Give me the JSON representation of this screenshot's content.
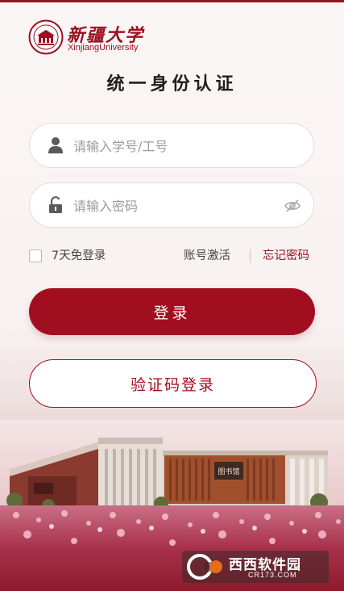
{
  "logo": {
    "name_cn": "新疆大学",
    "name_en": "XinjiangUniversity"
  },
  "title": "统一身份认证",
  "form": {
    "username_placeholder": "请输入学号/工号",
    "username_value": "",
    "password_placeholder": "请输入密码",
    "password_value": ""
  },
  "options": {
    "remember_label": "7天免登录",
    "remember_checked": false,
    "activate_label": "账号激活",
    "forgot_label": "忘记密码"
  },
  "buttons": {
    "login_label": "登录",
    "code_login_label": "验证码登录"
  },
  "building_sign": "图书馆",
  "watermark": {
    "text_cn": "西西软件园",
    "text_en": "CR173.COM"
  },
  "colors": {
    "brand": "#a10e1f",
    "text": "#1e1e1e",
    "placeholder": "#9b9b9b"
  },
  "icons": [
    "user-icon",
    "lock-icon",
    "eye-off-icon",
    "university-seal-icon"
  ]
}
